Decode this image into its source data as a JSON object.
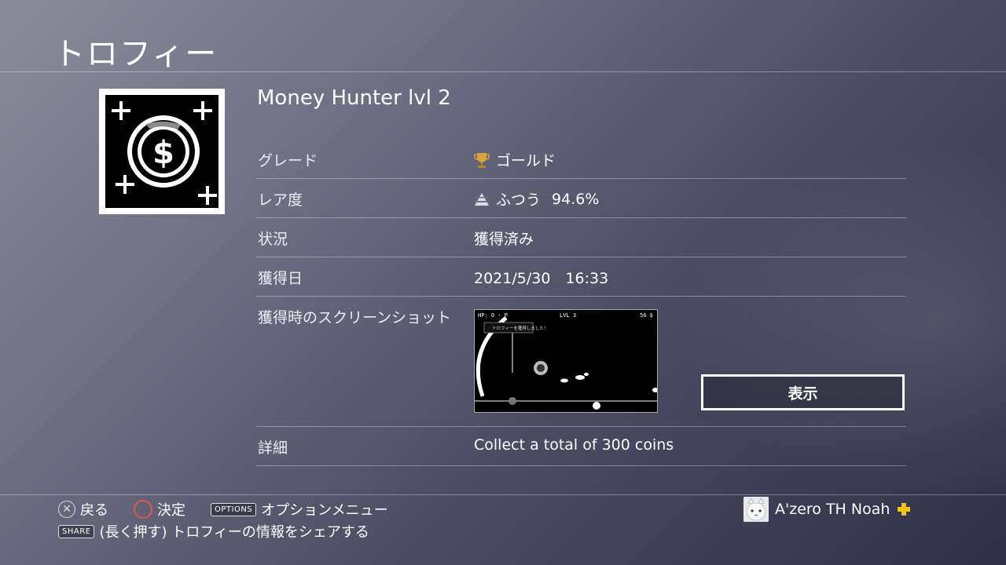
{
  "header": {
    "title": "トロフィー"
  },
  "trophy": {
    "name": "Money Hunter lvl 2",
    "icon": "dollar-coin-icon"
  },
  "details": {
    "grade": {
      "label": "グレード",
      "value": "ゴールド",
      "icon": "gold-trophy-icon",
      "color": "#d8a43a"
    },
    "rarity": {
      "label": "レア度",
      "value": "ふつう",
      "percent": "94.6%",
      "icon": "rarity-pyramid-icon"
    },
    "status": {
      "label": "状況",
      "value": "獲得済み"
    },
    "date": {
      "label": "獲得日",
      "value": "2021/5/30　16:33"
    },
    "screenshot": {
      "label": "獲得時のスクリーンショット",
      "view_button": "表示",
      "hud_left": "HP: 0 · P",
      "hud_center": "LVL 3",
      "hud_right": "56 $",
      "notice": "トロフィーを獲得しました！"
    },
    "description": {
      "label": "詳細",
      "value": "Collect a total of 300 coins"
    }
  },
  "footer": {
    "back": {
      "glyph": "✕",
      "label": "戻る"
    },
    "confirm": {
      "glyph": "○",
      "label": "決定"
    },
    "options": {
      "tag": "OPTIONS",
      "label": "オプションメニュー"
    },
    "share": {
      "tag": "SHARE",
      "label": "(長く押す) トロフィーの情報をシェアする"
    }
  },
  "user": {
    "name": "A'zero TH Noah",
    "badge": "plus-icon",
    "badge_color": "#f2c417"
  }
}
